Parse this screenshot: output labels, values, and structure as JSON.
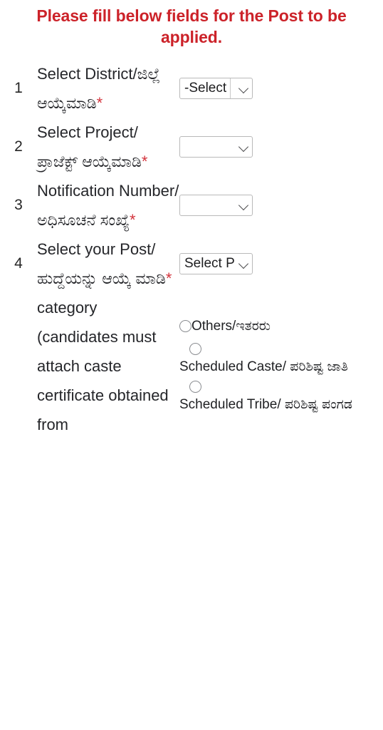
{
  "heading": "Please fill below fields for the Post to be applied.",
  "rows": [
    {
      "index": "1",
      "label": "Select District/ಜಿಲ್ಲೆ ಆಯ್ಕೆಮಾಡಿ",
      "required_mark": "*",
      "control": "select",
      "selected": "-Select"
    },
    {
      "index": "2",
      "label": "Select Project/ ಪ್ರಾಜೆಕ್ಟ್ ಆಯ್ಕೆಮಾಡಿ",
      "required_mark": "*",
      "control": "select",
      "selected": ""
    },
    {
      "index": "3",
      "label": "Notification Number/ ಅಧಿಸೂಚನೆ ಸಂಖ್ಯೆ",
      "required_mark": "*",
      "control": "select",
      "selected": ""
    },
    {
      "index": "4",
      "label": "Select your Post/ ಹುದ್ದೆಯನ್ನು ಆಯ್ಕೆ ಮಾಡಿ",
      "required_mark": "*",
      "control": "select",
      "selected": "Select P"
    },
    {
      "index": "",
      "label": "category (candidates must attach caste certificate obtained from",
      "required_mark": "",
      "control": "radio",
      "options": [
        {
          "label": "Others/ಇತರರು",
          "layout": "inline",
          "checked": false
        },
        {
          "label": "Scheduled Caste/ ಪರಿಶಿಷ್ಟ ಜಾತಿ",
          "layout": "stacked",
          "checked": false
        },
        {
          "label": "Scheduled Tribe/ ಪರಿಶಿಷ್ಟ ಪಂಗಡ",
          "layout": "stacked",
          "checked": false
        }
      ]
    }
  ],
  "colors": {
    "heading": "#cc2229",
    "required_star": "#d3333c",
    "text": "#1f2023",
    "control_border": "#b9b9b9",
    "background": "#ffffff"
  }
}
